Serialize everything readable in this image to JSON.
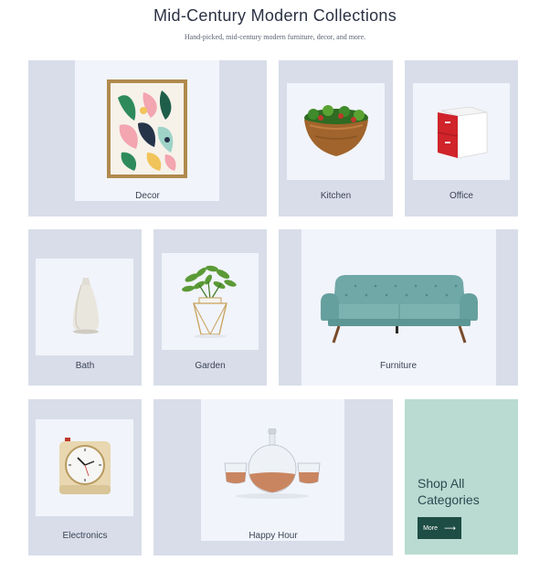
{
  "header": {
    "title": "Mid-Century Modern Collections",
    "subtitle": "Hand-picked, mid-century modern furniture, decor, and more."
  },
  "categories": [
    {
      "label": "Decor"
    },
    {
      "label": "Kitchen"
    },
    {
      "label": "Office"
    },
    {
      "label": "Bath"
    },
    {
      "label": "Garden"
    },
    {
      "label": "Furniture"
    },
    {
      "label": "Electronics"
    },
    {
      "label": "Happy Hour"
    }
  ],
  "cta": {
    "text": "Shop All Categories",
    "button_label": "More",
    "button_icon": "arrow-right-icon"
  },
  "colors": {
    "tile_bg": "#d8dde9",
    "tile_inner": "#f1f4fa",
    "cta_bg": "#b9dbd1",
    "cta_button": "#1d4d44"
  }
}
